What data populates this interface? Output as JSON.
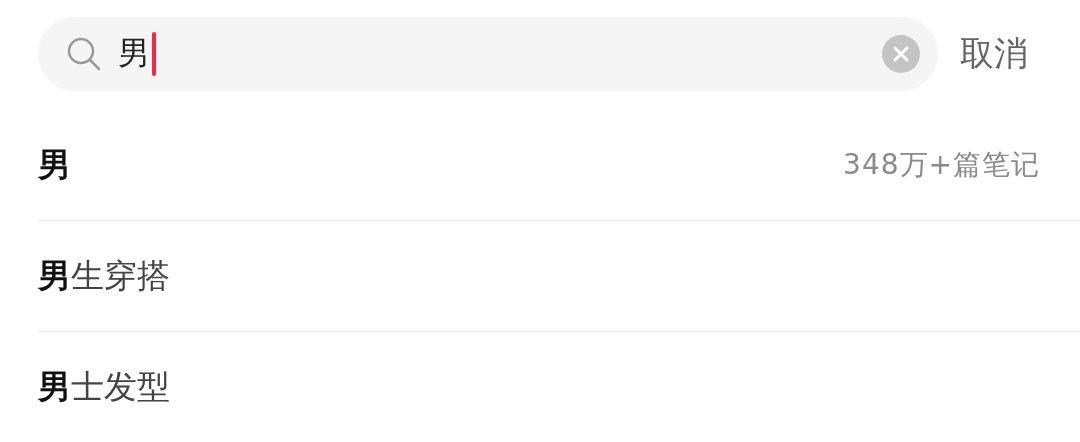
{
  "search": {
    "value": "男",
    "cancel": "取消"
  },
  "suggestions": [
    {
      "match": "男",
      "count": "348万+篇笔记"
    },
    {
      "match": "男",
      "rest": "生穿搭"
    },
    {
      "match": "男",
      "rest": "士发型"
    }
  ]
}
